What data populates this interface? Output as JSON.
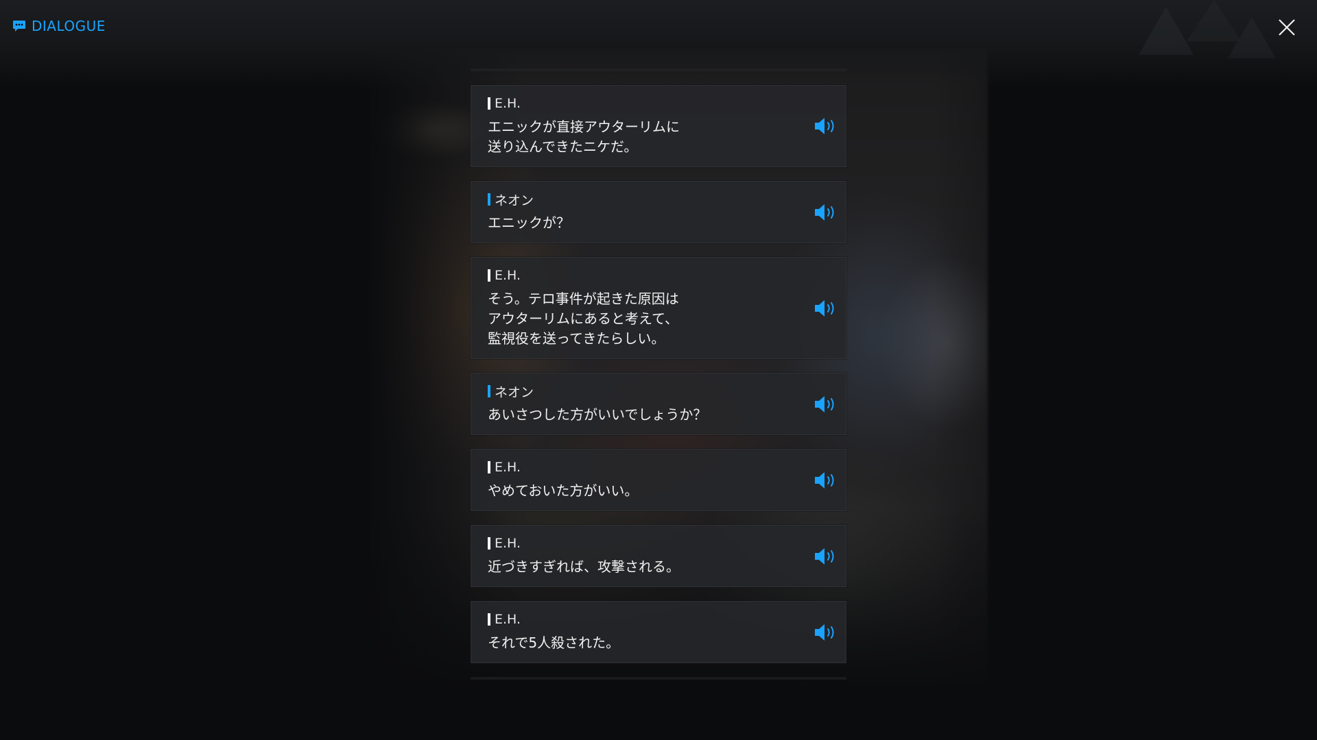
{
  "header": {
    "title": "DIALOGUE",
    "icon": "chat-bubble-icon",
    "accent_color": "#1aa3ff",
    "close_icon": "close-icon"
  },
  "speaker_colors": {
    "E.H.": "#ffffff",
    "ネオン": "#1aa3ff"
  },
  "dialogue": [
    {
      "speaker": "E.H.",
      "text": "エニックが直接アウターリムに\n送り込んできたニケだ。"
    },
    {
      "speaker": "ネオン",
      "text": "エニックが？"
    },
    {
      "speaker": "E.H.",
      "text": "そう。テロ事件が起きた原因は\nアウターリムにあると考えて、\n監視役を送ってきたらしい。"
    },
    {
      "speaker": "ネオン",
      "text": "あいさつした方がいいでしょうか？"
    },
    {
      "speaker": "E.H.",
      "text": "やめておいた方がいい。"
    },
    {
      "speaker": "E.H.",
      "text": "近づきすぎれば、攻撃される。"
    },
    {
      "speaker": "E.H.",
      "text": "それで5人殺された。"
    }
  ],
  "voice_icon": "speaker-volume-icon"
}
